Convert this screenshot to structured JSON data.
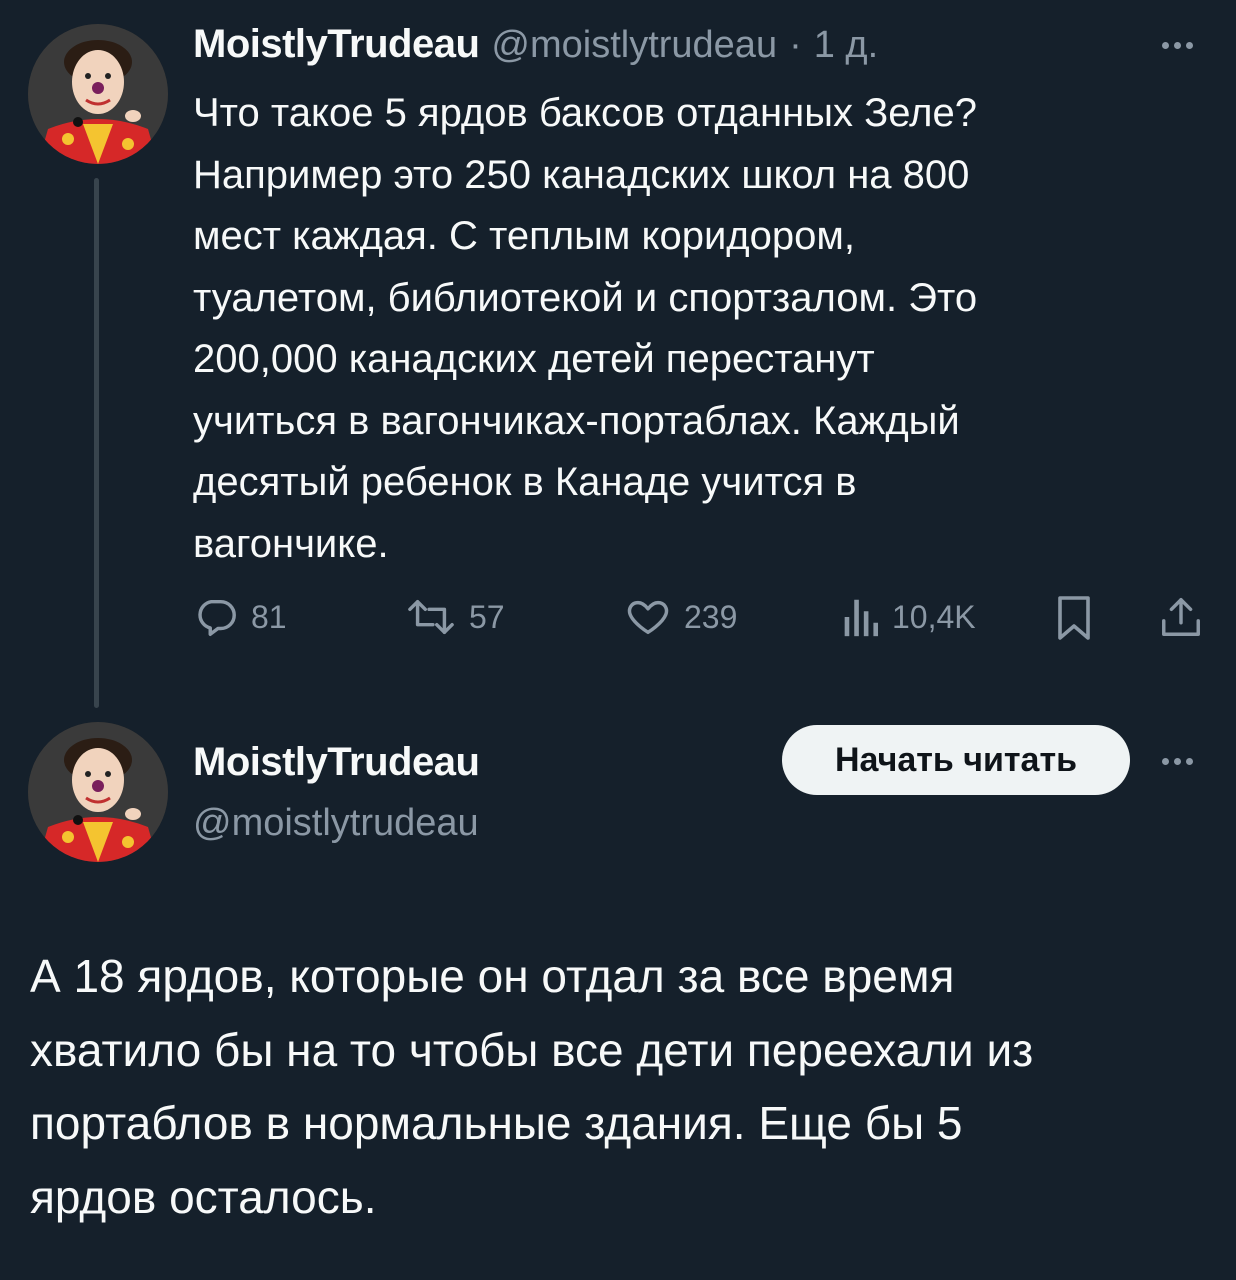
{
  "tweet": {
    "author_name": "MoistlyTrudeau",
    "author_handle": "@moistlytrudeau",
    "separator": "·",
    "timestamp": "1 д.",
    "text_lines": [
      "Что такое 5 ярдов баксов отданных Зеле?",
      "Например это 250 канадских школ на 800",
      "мест каждая. С теплым коридором,",
      "туалетом, библиотекой и спортзалом. Это",
      "200,000 канадских детей перестанут",
      "учиться в вагончиках-портаблах. Каждый",
      "десятый ребенок в Канаде учится в",
      "вагончике."
    ],
    "actions": {
      "replies": "81",
      "reposts": "57",
      "likes": "239",
      "views": "10,4K"
    },
    "icons": [
      "reply-icon",
      "repost-icon",
      "like-icon",
      "views-icon",
      "bookmark-icon",
      "share-icon",
      "more-icon"
    ]
  },
  "reply": {
    "author_name": "MoistlyTrudeau",
    "author_handle": "@moistlytrudeau",
    "follow_label": "Начать читать",
    "text_lines": [
      "А 18 ярдов, которые он отдал за все время",
      "хватило бы на то чтобы все дети переехали из",
      "портаблов в нормальные здания. Еще бы 5",
      "ярдов осталось."
    ]
  },
  "colors": {
    "background": "#15202b",
    "primary_text": "#f7f9f9",
    "secondary_text": "#8b98a5",
    "thread_line": "#38444d",
    "button_bg": "#eff3f4"
  }
}
